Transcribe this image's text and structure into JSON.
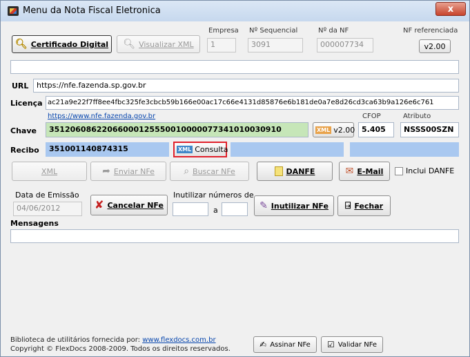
{
  "window": {
    "title": "Menu da Nota Fiscal Eletronica",
    "close": "x"
  },
  "toolbar": {
    "certificado_label": "Certificado Digital",
    "visualizar_label": "Visualizar XML",
    "empresa_label": "Empresa",
    "empresa_value": "1",
    "seq_label": "Nº Sequencial",
    "seq_value": "3091",
    "nf_label": "Nº da NF",
    "nf_value": "000007734",
    "nfref_label": "NF referenciada",
    "nfref_value": "v2.00"
  },
  "url": {
    "label": "URL",
    "value": "https://nfe.fazenda.sp.gov.br"
  },
  "licenca": {
    "label": "Licença",
    "value": "ac21a9e22f7ff8ee4fbc325fe3cbcb59b166e00ac17c66e4131d85876e6b181de0a7e8d26cd3ca63b9a126e6c761"
  },
  "chave": {
    "link": "https://www.nfe.fazenda.gov.br",
    "label": "Chave",
    "value": "35120608622066000125550010000077341010030910",
    "xml_version": "v2.00",
    "cfop_label": "CFOP",
    "cfop_value": "5.405",
    "atributo_label": "Atributo",
    "atributo_value": "NSSS00SZN"
  },
  "recibo": {
    "label": "Recibo",
    "value": "351001140874315",
    "consulta_label": "Consulta"
  },
  "actions": {
    "xml": "XML",
    "enviar": "Enviar NFe",
    "buscar": "Buscar NFe",
    "danfe": "DANFE",
    "email": "E-Mail",
    "inclui_danfe": "Inclui DANFE"
  },
  "emissao": {
    "label": "Data de Emissão",
    "value": "04/06/2012"
  },
  "cancelar": "Cancelar NFe",
  "inutilizar": {
    "label": "Inutilizar números de",
    "a_label": "a",
    "button": "Inutilizar NFe"
  },
  "fechar": "Fechar",
  "mensagens": {
    "label": "Mensagens"
  },
  "footer": {
    "line1_prefix": "Biblioteca de utilitários fornecida por:",
    "line1_link": "www.flexdocs.com.br",
    "line2": "Copyright © FlexDocs 2008-2009. Todos os direitos reservados.",
    "assinar": "Assinar NFe",
    "validar": "Validar NFe"
  },
  "colors": {
    "green_field": "#c6e6b8",
    "blue_field": "#a9c8f0",
    "highlight_border": "#e0202a"
  }
}
